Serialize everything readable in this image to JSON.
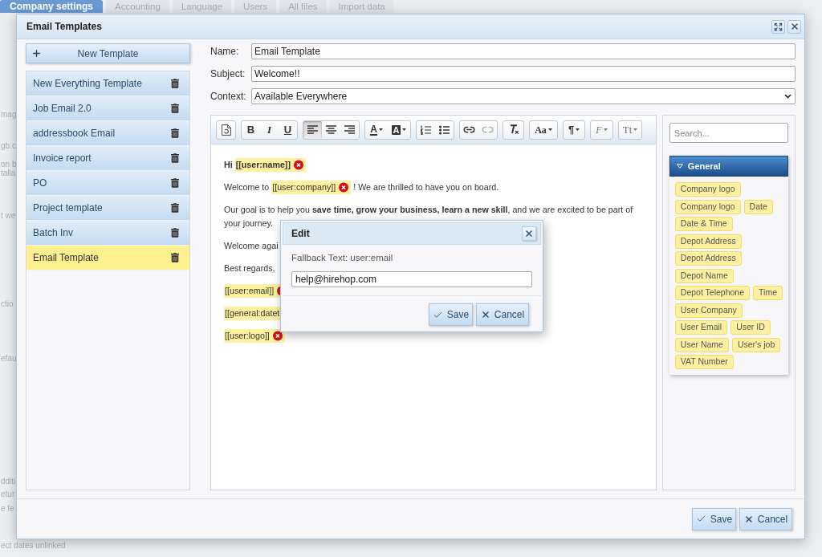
{
  "background": {
    "tabs": [
      {
        "label": "Company settings",
        "selected": true
      },
      {
        "label": "Accounting",
        "selected": false
      },
      {
        "label": "Language",
        "selected": false
      },
      {
        "label": "Users",
        "selected": false
      },
      {
        "label": "All files",
        "selected": false
      },
      {
        "label": "Import data",
        "selected": false
      }
    ],
    "fragments": [
      "mag",
      "gb.c",
      "on b",
      "talla",
      "t we",
      "ctio",
      "efau",
      "dditi",
      "etur",
      "e fe",
      "ect dates unlinked"
    ]
  },
  "window": {
    "title": "Email Templates"
  },
  "new_template_button": {
    "label": "New Template"
  },
  "templates": [
    {
      "name": "New Everything Template",
      "selected": false
    },
    {
      "name": "Job Email 2.0",
      "selected": false
    },
    {
      "name": "addressbook Email",
      "selected": false
    },
    {
      "name": "Invoice report",
      "selected": false
    },
    {
      "name": "PO",
      "selected": false
    },
    {
      "name": "Project template",
      "selected": false
    },
    {
      "name": "Batch Inv",
      "selected": false
    },
    {
      "name": "Email Template",
      "selected": true
    }
  ],
  "fields": [
    {
      "label": "Name:",
      "kind": "text",
      "value": "Email Template"
    },
    {
      "label": "Subject:",
      "kind": "text",
      "value": "Welcome!!"
    },
    {
      "label": "Context:",
      "kind": "select",
      "value": "Available Everywhere"
    }
  ],
  "toolbar": {
    "groups": [
      {
        "buttons": [
          {
            "kind": "source",
            "pressed": false,
            "disabled": false
          }
        ]
      },
      {
        "buttons": [
          {
            "kind": "bold",
            "label": "B",
            "pressed": false,
            "disabled": false
          },
          {
            "kind": "italic",
            "label": "I",
            "pressed": false,
            "disabled": false
          },
          {
            "kind": "underline",
            "label": "U",
            "pressed": false,
            "disabled": false
          }
        ]
      },
      {
        "buttons": [
          {
            "kind": "alignleft",
            "pressed": true,
            "disabled": false
          },
          {
            "kind": "aligncenter",
            "pressed": false,
            "disabled": false
          },
          {
            "kind": "alignright",
            "pressed": false,
            "disabled": false
          }
        ]
      },
      {
        "buttons": [
          {
            "kind": "textcolor",
            "label": "A",
            "pressed": false,
            "disabled": false
          },
          {
            "kind": "bgcolor",
            "label": "A",
            "pressed": false,
            "disabled": false
          }
        ]
      },
      {
        "buttons": [
          {
            "kind": "numbered",
            "pressed": false,
            "disabled": false
          },
          {
            "kind": "bulleted",
            "pressed": false,
            "disabled": false
          }
        ]
      },
      {
        "buttons": [
          {
            "kind": "link",
            "pressed": false,
            "disabled": false
          },
          {
            "kind": "unlink",
            "pressed": false,
            "disabled": true
          }
        ]
      },
      {
        "buttons": [
          {
            "kind": "clearformat",
            "pressed": false,
            "disabled": false
          }
        ]
      },
      {
        "buttons": [
          {
            "kind": "styles",
            "label": "Aa",
            "pressed": false,
            "disabled": false
          }
        ]
      },
      {
        "buttons": [
          {
            "kind": "paragraph",
            "label": "¶",
            "pressed": false,
            "disabled": false
          }
        ]
      },
      {
        "buttons": [
          {
            "kind": "font",
            "label": "F",
            "pressed": false,
            "disabled": false
          }
        ]
      },
      {
        "buttons": [
          {
            "kind": "size",
            "label": "Tt",
            "pressed": false,
            "disabled": false
          }
        ]
      }
    ]
  },
  "editor": {
    "paragraphs": [
      {
        "bold": true,
        "segments": [
          {
            "kind": "text",
            "text": "Hi "
          },
          {
            "kind": "token",
            "text": "[[user:name]]",
            "removable": true
          }
        ]
      },
      {
        "bold": false,
        "segments": [
          {
            "kind": "text",
            "text": "Welcome to "
          },
          {
            "kind": "token",
            "text": "[[user:company]]",
            "removable": true
          },
          {
            "kind": "text",
            "text": " ! We are thrilled to have you on board."
          }
        ]
      },
      {
        "bold": false,
        "segments": [
          {
            "kind": "text",
            "text": "Our goal is to help you **save time, grow your business, learn a new skill**, and we are excited to be part of your journey."
          }
        ]
      },
      {
        "bold": false,
        "segments": [
          {
            "kind": "text",
            "text": "Welcome agai"
          }
        ]
      },
      {
        "bold": false,
        "segments": [
          {
            "kind": "text",
            "text": "Best regards,"
          }
        ]
      },
      {
        "bold": false,
        "segments": [
          {
            "kind": "token",
            "text": "[[user:email]]",
            "removable": true
          }
        ]
      },
      {
        "bold": false,
        "segments": [
          {
            "kind": "token",
            "text": "[[general:datet"
          }
        ]
      },
      {
        "bold": false,
        "segments": [
          {
            "kind": "token",
            "text": "[[user:logo]]",
            "removable": true
          }
        ]
      }
    ]
  },
  "tag_panel": {
    "search": {
      "placeholder": "Search..."
    },
    "groups": [
      {
        "title": "General",
        "expanded": true,
        "rows": [
          [
            "Company logo"
          ],
          [
            "Company logo",
            "Date"
          ],
          [
            "Date & Time"
          ],
          [
            "Depot Address"
          ],
          [
            "Depot Address"
          ],
          [
            "Depot Name"
          ],
          [
            "Depot Telephone",
            "Time"
          ],
          [
            "User Company"
          ],
          [
            "User Email",
            "User ID"
          ],
          [
            "User Name",
            "User's job"
          ],
          [
            "VAT Number"
          ]
        ]
      }
    ]
  },
  "footer_buttons": [
    {
      "kind": "save",
      "label": "Save"
    },
    {
      "kind": "cancel",
      "label": "Cancel"
    }
  ],
  "edit_dialog": {
    "title": "Edit",
    "label": "Fallback Text: user:email",
    "value": "help@hirehop.com",
    "buttons": [
      {
        "kind": "save",
        "label": "Save"
      },
      {
        "kind": "cancel",
        "label": "Cancel"
      }
    ]
  }
}
